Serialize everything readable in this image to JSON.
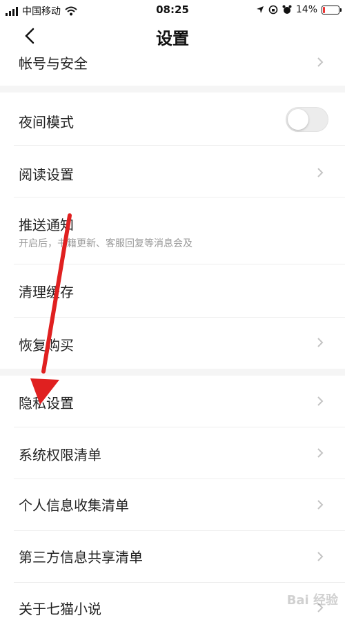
{
  "status_bar": {
    "carrier": "中国移动",
    "time": "08:25",
    "battery": "14%"
  },
  "nav": {
    "title": "设置"
  },
  "settings": {
    "account": "帐号与安全",
    "night_mode": "夜间模式",
    "night_mode_on": false,
    "reading": "阅读设置",
    "push": "推送通知",
    "push_desc": "开启后，书籍更新、客服回复等消息会及",
    "clear_cache": "清理缓存",
    "restore": "恢复购买",
    "privacy": "隐私设置",
    "permissions": "系统权限清单",
    "personal_info": "个人信息收集清单",
    "third_party": "第三方信息共享清单",
    "about": "关于七猫小说"
  },
  "colors": {
    "annotation_arrow": "#e02020",
    "gap_bg": "#f5f5f5"
  },
  "watermark": "Bai 经验"
}
